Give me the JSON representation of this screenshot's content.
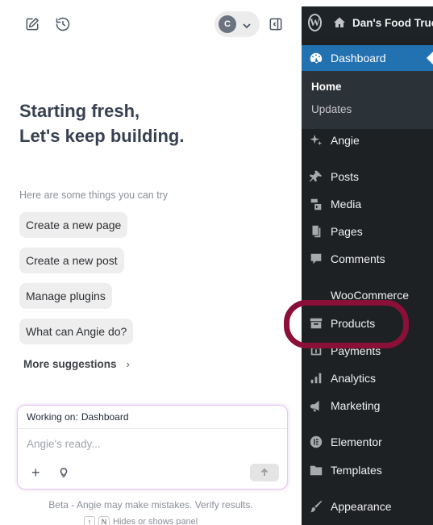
{
  "angie": {
    "heading_line1": "Starting fresh,",
    "heading_line2": "Let's keep building.",
    "hint": "Here are some things you can try",
    "user_initial": "C",
    "suggestions": [
      {
        "label": "Create a new page"
      },
      {
        "label": "Create a new post"
      },
      {
        "label": "Manage plugins"
      },
      {
        "label": "What can Angie do?"
      }
    ],
    "more_label": "More suggestions",
    "working_on_label": "Working on:",
    "working_on_value": "Dashboard",
    "prompt_placeholder": "Angie's ready...",
    "beta_note": "Beta - Angie may make mistakes. Verify results.",
    "shortcut_text": "Hides or shows panel"
  },
  "wp": {
    "site_name": "Dan's Food Truck",
    "dashboard_label": "Dashboard",
    "submenu": {
      "home": "Home",
      "updates": "Updates"
    },
    "menu": [
      {
        "label": "Angie",
        "icon": "sparkle-icon"
      },
      {
        "label": "Posts",
        "icon": "pin-icon"
      },
      {
        "label": "Media",
        "icon": "media-icon"
      },
      {
        "label": "Pages",
        "icon": "pages-icon"
      },
      {
        "label": "Comments",
        "icon": "comment-icon"
      },
      {
        "label": "WooCommerce",
        "icon": "woocommerce-icon"
      },
      {
        "label": "Products",
        "icon": "archive-icon"
      },
      {
        "label": "Payments",
        "icon": "payments-icon"
      },
      {
        "label": "Analytics",
        "icon": "bar-chart-icon"
      },
      {
        "label": "Marketing",
        "icon": "megaphone-icon"
      },
      {
        "label": "Elementor",
        "icon": "elementor-icon"
      },
      {
        "label": "Templates",
        "icon": "folder-icon"
      },
      {
        "label": "Appearance",
        "icon": "brush-icon"
      }
    ]
  },
  "colors": {
    "wp_accent": "#2271b1",
    "highlight_ring": "#8b1038",
    "composer_border": "#e6c6ee"
  }
}
